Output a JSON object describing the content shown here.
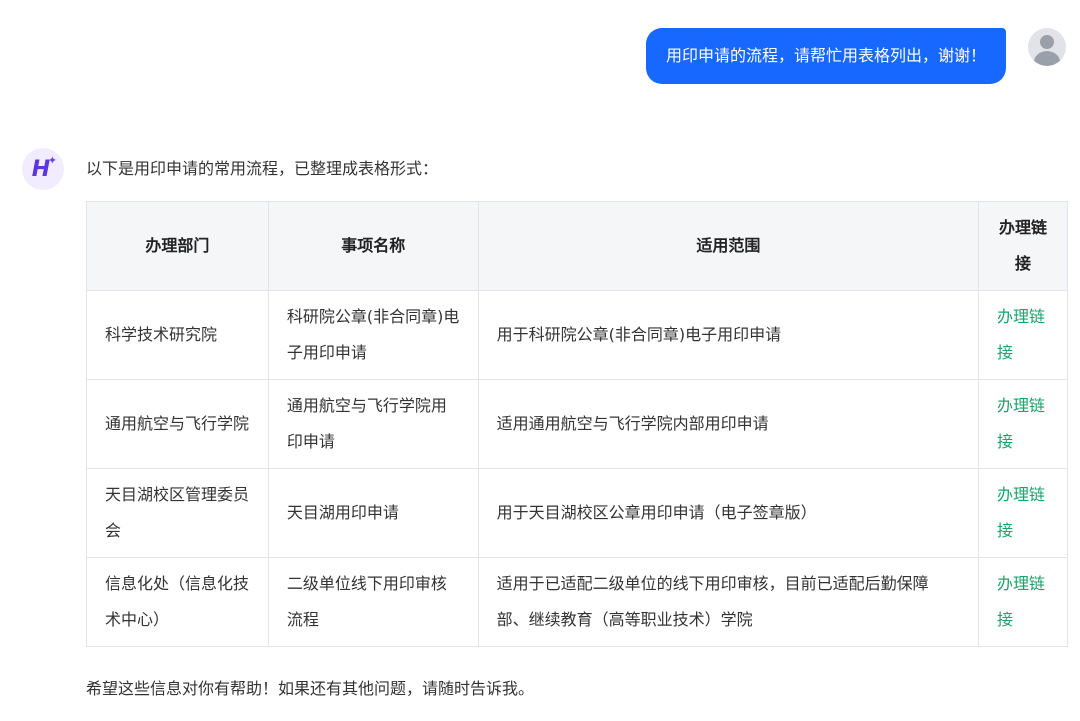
{
  "user_message": "用印申请的流程，请帮忙用表格列出，谢谢！",
  "assistant": {
    "intro": "以下是用印申请的常用流程，已整理成表格形式：",
    "table": {
      "headers": [
        "办理部门",
        "事项名称",
        "适用范围",
        "办理链接"
      ],
      "rows": [
        {
          "department": "科学技术研究院",
          "item": "科研院公章(非合同章)电子用印申请",
          "scope": "用于科研院公章(非合同章)电子用印申请",
          "link": "办理链接"
        },
        {
          "department": "通用航空与飞行学院",
          "item": "通用航空与飞行学院用印申请",
          "scope": "适用通用航空与飞行学院内部用印申请",
          "link": "办理链接"
        },
        {
          "department": "天目湖校区管理委员会",
          "item": "天目湖用印申请",
          "scope": "用于天目湖校区公章用印申请（电子签章版）",
          "link": "办理链接"
        },
        {
          "department": "信息化处（信息化技术中心）",
          "item": "二级单位线下用印审核流程",
          "scope": "适用于已适配二级单位的线下用印审核，目前已适配后勤保障部、继续教育（高等职业技术）学院",
          "link": "办理链接"
        }
      ]
    },
    "closing": "希望这些信息对你有帮助！如果还有其他问题，请随时告诉我。"
  },
  "icons": {
    "user_avatar": "user-avatar-icon",
    "bot_avatar": "assistant-logo-icon"
  },
  "colors": {
    "user_bubble": "#1668ff",
    "link": "#1aa36b",
    "bot_logo": "#5a35e0"
  }
}
